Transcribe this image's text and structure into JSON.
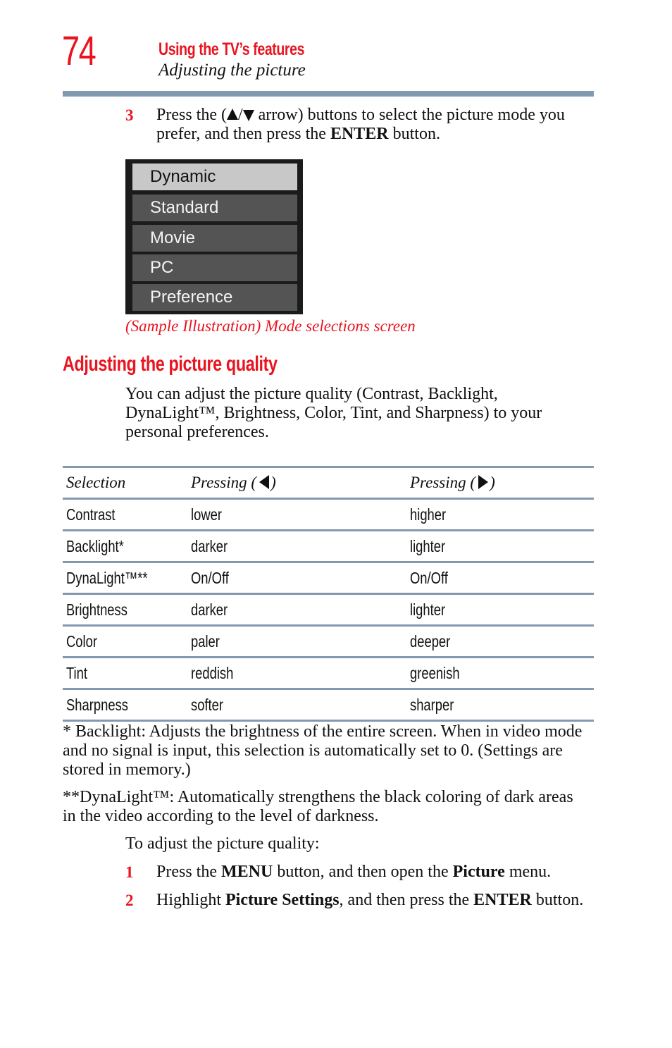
{
  "header": {
    "page_number": "74",
    "chapter": "Using the TV’s features",
    "section": "Adjusting the picture"
  },
  "step3": {
    "number": "3",
    "text_before": "Press the (",
    "up_icon": "up-triangle-icon",
    "slash": "/",
    "down_icon": "down-triangle-icon",
    "text_after": " arrow) buttons to select the picture mode you",
    "line2_before": "prefer, and then press the ",
    "line2_bold": "ENTER",
    "line2_after": " button."
  },
  "tv_menu": {
    "items": [
      "Dynamic",
      "Standard",
      "Movie",
      "PC",
      "Preference"
    ],
    "selected": "Dynamic"
  },
  "caption": "(Sample Illustration) Mode selections screen",
  "heading": "Adjusting the picture quality",
  "intro": {
    "line1": "You can adjust the picture quality (Contrast, Backlight,",
    "line2": "DynaLight™, Brightness, Color, Tint, and Sharpness) to your",
    "line3": "personal preferences."
  },
  "table": {
    "headers": {
      "selection": "Selection",
      "left": "Pressing (",
      "left_icon": "left-triangle-icon",
      "right": "Pressing (",
      "right_icon": "right-triangle-icon",
      "close": ")"
    },
    "rows": [
      [
        "Contrast",
        "lower",
        "higher"
      ],
      [
        "Backlight*",
        "darker",
        "lighter"
      ],
      [
        "DynaLight™**",
        "On/Off",
        "On/Off"
      ],
      [
        "Brightness",
        "darker",
        "lighter"
      ],
      [
        "Color",
        "paler",
        "deeper"
      ],
      [
        "Tint",
        "reddish",
        "greenish"
      ],
      [
        "Sharpness",
        "softer",
        "sharper"
      ]
    ]
  },
  "footnotes": {
    "backlight": {
      "line1": "* Backlight: Adjusts the brightness of the entire screen. When in video mode",
      "line2": "and no signal is input, this selection is automatically set to 0. (Settings are",
      "line3": "stored in memory.)"
    },
    "dynalight": {
      "line1": "**DynaLight™: Automatically strengthens the black coloring of dark areas",
      "line2": "in the video according to the level of darkness."
    }
  },
  "procedure": {
    "intro": "To adjust the picture quality:",
    "steps": [
      {
        "number": "1",
        "t1": "Press the ",
        "b1": "MENU",
        "t2": " button, and then open the ",
        "b2": "Picture",
        "t3": " menu."
      },
      {
        "number": "2",
        "t1": "Highlight ",
        "b1": "Picture Settings",
        "t2": ", and then press the ",
        "b2": "ENTER",
        "t3": " button."
      }
    ]
  },
  "colors": {
    "accent_red": "#e8141f",
    "rule_blue_gray": "#8299b0",
    "menu_bg": "#1b1b1b",
    "menu_item": "#545454",
    "menu_selected": "#c8c8c8"
  }
}
